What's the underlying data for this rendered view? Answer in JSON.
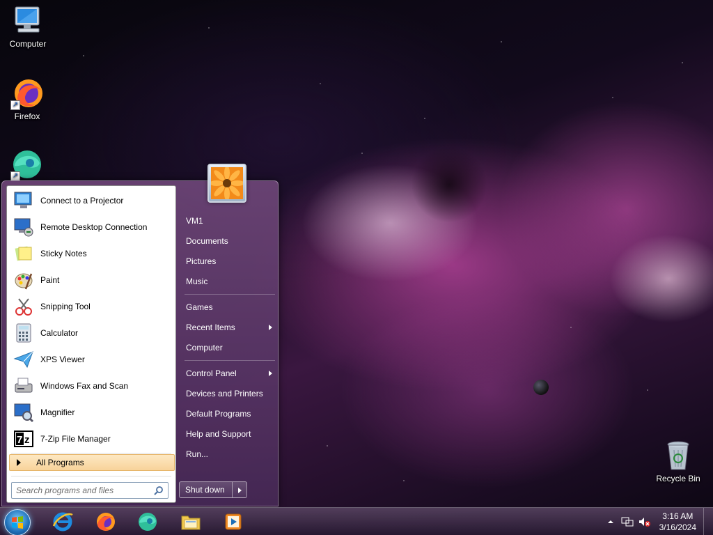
{
  "desktop": {
    "icons": [
      {
        "label": "Computer",
        "icon": "computer-icon"
      },
      {
        "label": "Firefox",
        "icon": "firefox-icon"
      },
      {
        "label": "",
        "icon": "edge-icon"
      },
      {
        "label": "Recycle Bin",
        "icon": "recycle-bin-icon"
      }
    ]
  },
  "start_menu": {
    "programs": [
      {
        "label": "Connect to a Projector",
        "icon": "projector-icon"
      },
      {
        "label": "Remote Desktop Connection",
        "icon": "remote-desktop-icon"
      },
      {
        "label": "Sticky Notes",
        "icon": "sticky-notes-icon"
      },
      {
        "label": "Paint",
        "icon": "paint-icon"
      },
      {
        "label": "Snipping Tool",
        "icon": "snipping-tool-icon"
      },
      {
        "label": "Calculator",
        "icon": "calculator-icon"
      },
      {
        "label": "XPS Viewer",
        "icon": "xps-viewer-icon"
      },
      {
        "label": "Windows Fax and Scan",
        "icon": "fax-scan-icon"
      },
      {
        "label": "Magnifier",
        "icon": "magnifier-icon"
      },
      {
        "label": "7-Zip File Manager",
        "icon": "7zip-icon"
      }
    ],
    "all_programs": "All Programs",
    "search_placeholder": "Search programs and files",
    "right_items": [
      {
        "label": "VM1"
      },
      {
        "label": "Documents"
      },
      {
        "label": "Pictures"
      },
      {
        "label": "Music"
      },
      {
        "label": "Games"
      },
      {
        "label": "Recent Items"
      },
      {
        "label": "Computer"
      },
      {
        "label": "Control Panel"
      },
      {
        "label": "Devices and Printers"
      },
      {
        "label": "Default Programs"
      },
      {
        "label": "Help and Support"
      },
      {
        "label": "Run..."
      }
    ],
    "shutdown_label": "Shut down"
  },
  "taskbar": {
    "apps": [
      "internet-explorer-icon",
      "firefox-icon",
      "edge-icon",
      "file-explorer-icon",
      "media-player-icon"
    ],
    "clock": {
      "time": "3:16 AM",
      "date": "3/16/2024"
    }
  },
  "colors": {
    "accent_hover": "#f8d39a",
    "start_orb": "#1e6fb8"
  }
}
